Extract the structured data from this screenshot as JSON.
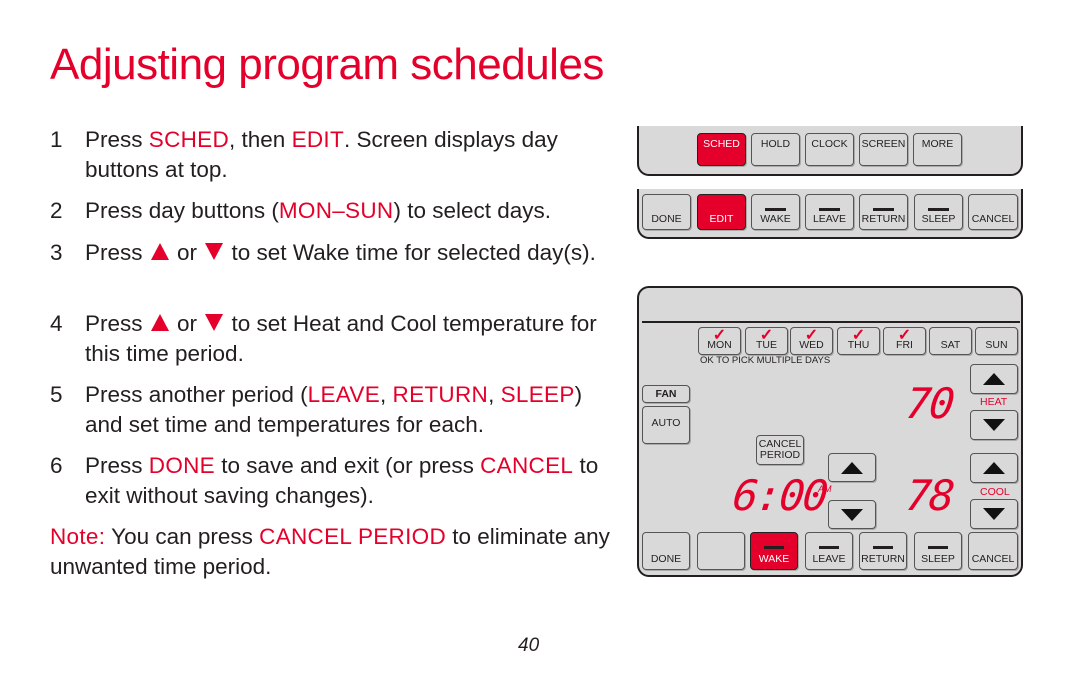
{
  "title": "Adjusting program schedules",
  "steps": [
    {
      "n": "1",
      "parts": [
        "Press ",
        "SCHED",
        ", then ",
        "EDIT",
        ". Screen displays day buttons at top."
      ]
    },
    {
      "n": "2",
      "parts": [
        "Press day buttons (",
        "MON–SUN",
        ") to select days."
      ]
    },
    {
      "n": "3",
      "parts": [
        "Press ",
        " or ",
        " to set Wake time for selected day(s)."
      ]
    },
    {
      "n": "4",
      "parts": [
        "Press ",
        " or ",
        " to set Heat and Cool temperature for this time period."
      ]
    },
    {
      "n": "5",
      "parts": [
        "Press another period (",
        "LEAVE",
        ", ",
        "RETURN",
        ", ",
        "SLEEP",
        ") and set time and temperatures for each."
      ]
    },
    {
      "n": "6",
      "parts": [
        "Press ",
        "DONE",
        " to save and exit (or press ",
        "CANCEL",
        " to exit without saving changes)."
      ]
    }
  ],
  "note": {
    "label": "Note:",
    "text1": " You can press ",
    "highlight": "CANCEL PERIOD",
    "text2": " to eliminate any unwanted time period."
  },
  "page_number": "40",
  "accent_color": "#e4002b",
  "screen1": {
    "top": [
      "SCHED",
      "HOLD",
      "CLOCK",
      "SCREEN",
      "MORE"
    ],
    "active_top": "SCHED",
    "bottom": [
      "DONE",
      "EDIT",
      "WAKE",
      "LEAVE",
      "RETURN",
      "SLEEP",
      "CANCEL"
    ],
    "active_bottom": "EDIT"
  },
  "screen2": {
    "days": [
      {
        "label": "MON",
        "checked": true
      },
      {
        "label": "TUE",
        "checked": true
      },
      {
        "label": "WED",
        "checked": true
      },
      {
        "label": "THU",
        "checked": true
      },
      {
        "label": "FRI",
        "checked": true
      },
      {
        "label": "SAT",
        "checked": false
      },
      {
        "label": "SUN",
        "checked": false
      }
    ],
    "check": "✓",
    "hint": "OK TO PICK MULTIPLE DAYS",
    "fan_label": "FAN",
    "fan_mode": "AUTO",
    "cancel_period": [
      "CANCEL",
      "PERIOD"
    ],
    "heat_temp": "70",
    "heat_label": "HEAT",
    "cool_temp": "78",
    "cool_label": "COOL",
    "time": "6:00",
    "ampm": "AM",
    "bottom": [
      "DONE",
      "",
      "WAKE",
      "LEAVE",
      "RETURN",
      "SLEEP",
      "CANCEL"
    ],
    "active_bottom": "WAKE"
  }
}
